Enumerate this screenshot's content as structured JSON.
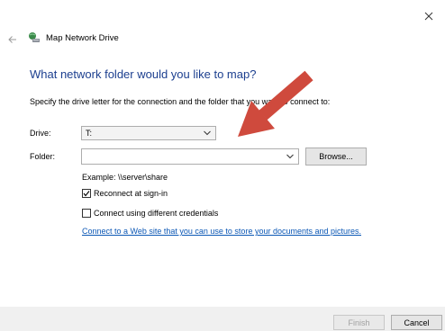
{
  "window": {
    "title": "Map Network Drive",
    "close_icon": "close-icon",
    "back_icon": "back-arrow-icon",
    "app_icon": "network-drive-icon"
  },
  "main": {
    "heading": "What network folder would you like to map?",
    "instructions": "Specify the drive letter for the connection and the folder that you want to connect to:",
    "drive_label": "Drive:",
    "drive_value": "T:",
    "folder_label": "Folder:",
    "folder_value": "",
    "browse_label": "Browse...",
    "example": "Example: \\\\server\\share",
    "reconnect_label": "Reconnect at sign-in",
    "reconnect_checked": true,
    "credentials_label": "Connect using different credentials",
    "credentials_checked": false,
    "link_text": "Connect to a Web site that you can use to store your documents and pictures."
  },
  "footer": {
    "finish_label": "Finish",
    "cancel_label": "Cancel"
  },
  "colors": {
    "heading": "#1c3f8f",
    "link": "#0b57b5",
    "annotation_arrow": "#cf4a3d"
  }
}
